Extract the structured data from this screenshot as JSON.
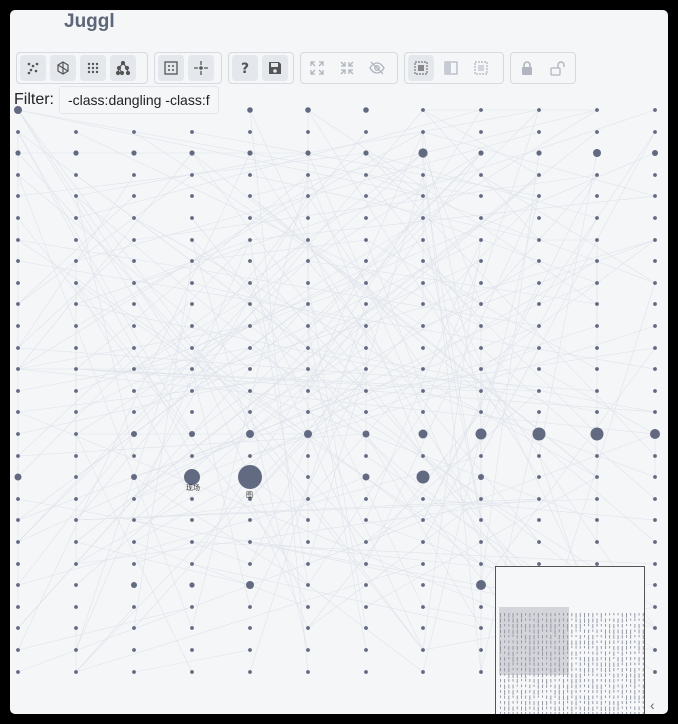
{
  "app": {
    "title": "Juggl"
  },
  "toolbar": {
    "groups": [
      [
        "layout-fdgd-icon",
        "layout-cola-icon",
        "layout-grid-icon",
        "layout-dagre-icon"
      ],
      [
        "fit-icon",
        "center-icon"
      ],
      [
        "help-icon",
        "save-icon"
      ],
      [
        "expand-icon",
        "collapse-icon",
        "hide-icon"
      ],
      [
        "select-all-icon",
        "invert-selection-icon",
        "select-none-icon"
      ],
      [
        "lock-icon",
        "unlock-icon"
      ]
    ]
  },
  "filter": {
    "label": "Filter:",
    "value": "-class:dangling -class:fi"
  },
  "graph": {
    "node_color": "#626a82",
    "edge_color": "#dfe3ea",
    "labeled_nodes": [
      {
        "label": "现场"
      },
      {
        "label": "图"
      }
    ]
  },
  "minimap": {
    "collapse_glyph": "‹"
  }
}
